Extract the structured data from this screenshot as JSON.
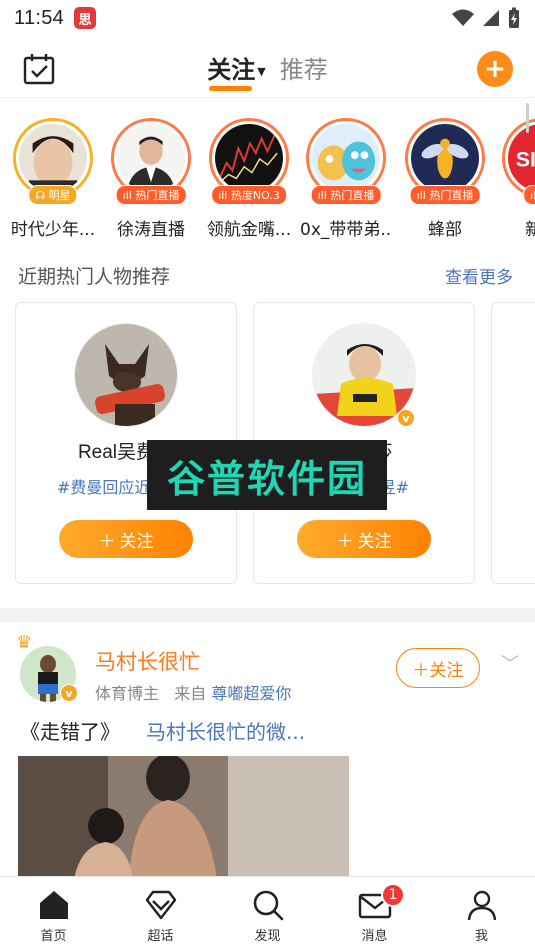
{
  "status_bar": {
    "time": "11:54",
    "app_icon_text": "思"
  },
  "header": {
    "tabs": [
      {
        "label": "关注",
        "active": true
      },
      {
        "label": "推荐",
        "active": false
      }
    ],
    "accent_color": "#ff8200"
  },
  "stories": [
    {
      "name": "时代少年...",
      "badge": "明星",
      "badge_icon": "headphone-icon",
      "ring": "gold"
    },
    {
      "name": "徐涛直播",
      "badge": "热门直播",
      "badge_icon": "live-bars-icon",
      "ring": "red"
    },
    {
      "name": "领航金嘴...",
      "badge": "热度NO.3",
      "badge_icon": "live-bars-icon",
      "ring": "red"
    },
    {
      "name": "0x_带带弟...",
      "badge": "热门直播",
      "badge_icon": "live-bars-icon",
      "ring": "red"
    },
    {
      "name": "蜂部",
      "badge": "热门直播",
      "badge_icon": "live-bars-icon",
      "ring": "red"
    },
    {
      "name": "新浪",
      "badge": "热",
      "badge_icon": "live-bars-icon",
      "ring": "red"
    }
  ],
  "recommend": {
    "title": "近期热门人物推荐",
    "more": "查看更多",
    "cards": [
      {
        "name": "Real吴费曼",
        "tag": "#费曼回应近日...#",
        "follow": "关注",
        "verified": false
      },
      {
        "name": "孙颖莎",
        "tag": "#...王曼昱#",
        "follow": "关注",
        "verified": true
      }
    ]
  },
  "watermark": {
    "text": "谷普软件园"
  },
  "post": {
    "author": "马村长很忙",
    "role": "体育博主",
    "source_prefix": "来自",
    "source": "尊嘟超爱你",
    "follow": "关注",
    "text": "《走错了》",
    "link_text": "马村长很忙的微..."
  },
  "bottom_nav": [
    {
      "label": "首页",
      "icon": "home-icon"
    },
    {
      "label": "超话",
      "icon": "diamond-icon"
    },
    {
      "label": "发现",
      "icon": "search-icon"
    },
    {
      "label": "消息",
      "icon": "mail-icon",
      "badge": "1"
    },
    {
      "label": "我",
      "icon": "person-icon"
    }
  ]
}
